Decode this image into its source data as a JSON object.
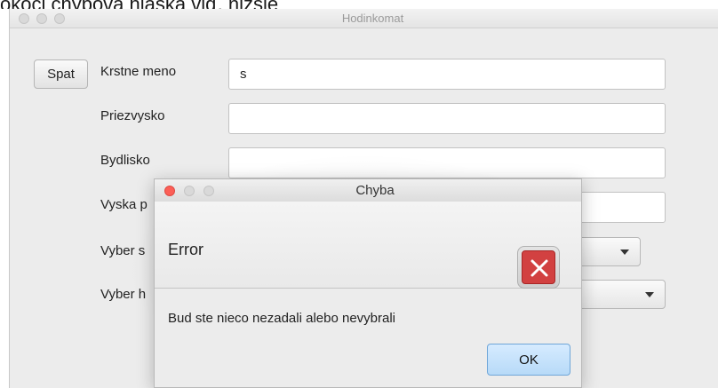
{
  "document": {
    "caption": "okoči chybová hláska viď. nižšie"
  },
  "main_window": {
    "title": "Hodinkomat",
    "back_button_label": "Spat",
    "fields": [
      {
        "label": "Krstne meno",
        "value": "s"
      },
      {
        "label": "Priezvysko",
        "value": ""
      },
      {
        "label": "Bydlisko",
        "value": ""
      },
      {
        "label": "Vyska p",
        "value": ""
      }
    ],
    "combos": [
      {
        "label": "Vyber s"
      },
      {
        "label": "Vyber h"
      }
    ]
  },
  "dialog": {
    "title": "Chyba",
    "header_text": "Error",
    "icon": "error-x-icon",
    "message": "Bud ste nieco nezadali alebo nevybrali",
    "ok_label": "OK"
  },
  "colors": {
    "window_bg": "#ececec",
    "error_red": "#d24141",
    "ok_button_blue": "#b7daf8",
    "close_dot_red": "#fc5f57"
  }
}
